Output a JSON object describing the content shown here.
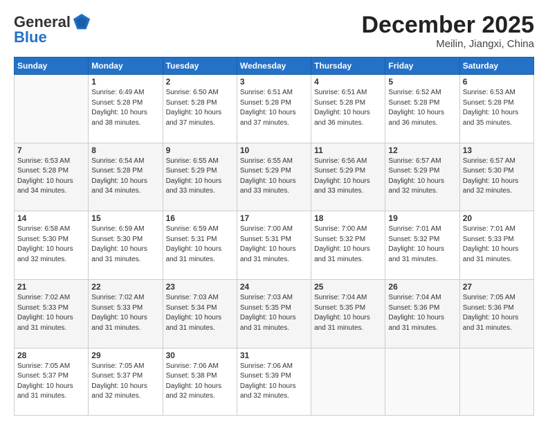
{
  "header": {
    "logo_general": "General",
    "logo_blue": "Blue",
    "month": "December 2025",
    "location": "Meilin, Jiangxi, China"
  },
  "weekdays": [
    "Sunday",
    "Monday",
    "Tuesday",
    "Wednesday",
    "Thursday",
    "Friday",
    "Saturday"
  ],
  "weeks": [
    [
      {
        "day": "",
        "info": ""
      },
      {
        "day": "1",
        "info": "Sunrise: 6:49 AM\nSunset: 5:28 PM\nDaylight: 10 hours\nand 38 minutes."
      },
      {
        "day": "2",
        "info": "Sunrise: 6:50 AM\nSunset: 5:28 PM\nDaylight: 10 hours\nand 37 minutes."
      },
      {
        "day": "3",
        "info": "Sunrise: 6:51 AM\nSunset: 5:28 PM\nDaylight: 10 hours\nand 37 minutes."
      },
      {
        "day": "4",
        "info": "Sunrise: 6:51 AM\nSunset: 5:28 PM\nDaylight: 10 hours\nand 36 minutes."
      },
      {
        "day": "5",
        "info": "Sunrise: 6:52 AM\nSunset: 5:28 PM\nDaylight: 10 hours\nand 36 minutes."
      },
      {
        "day": "6",
        "info": "Sunrise: 6:53 AM\nSunset: 5:28 PM\nDaylight: 10 hours\nand 35 minutes."
      }
    ],
    [
      {
        "day": "7",
        "info": "Sunrise: 6:53 AM\nSunset: 5:28 PM\nDaylight: 10 hours\nand 34 minutes."
      },
      {
        "day": "8",
        "info": "Sunrise: 6:54 AM\nSunset: 5:28 PM\nDaylight: 10 hours\nand 34 minutes."
      },
      {
        "day": "9",
        "info": "Sunrise: 6:55 AM\nSunset: 5:29 PM\nDaylight: 10 hours\nand 33 minutes."
      },
      {
        "day": "10",
        "info": "Sunrise: 6:55 AM\nSunset: 5:29 PM\nDaylight: 10 hours\nand 33 minutes."
      },
      {
        "day": "11",
        "info": "Sunrise: 6:56 AM\nSunset: 5:29 PM\nDaylight: 10 hours\nand 33 minutes."
      },
      {
        "day": "12",
        "info": "Sunrise: 6:57 AM\nSunset: 5:29 PM\nDaylight: 10 hours\nand 32 minutes."
      },
      {
        "day": "13",
        "info": "Sunrise: 6:57 AM\nSunset: 5:30 PM\nDaylight: 10 hours\nand 32 minutes."
      }
    ],
    [
      {
        "day": "14",
        "info": "Sunrise: 6:58 AM\nSunset: 5:30 PM\nDaylight: 10 hours\nand 32 minutes."
      },
      {
        "day": "15",
        "info": "Sunrise: 6:59 AM\nSunset: 5:30 PM\nDaylight: 10 hours\nand 31 minutes."
      },
      {
        "day": "16",
        "info": "Sunrise: 6:59 AM\nSunset: 5:31 PM\nDaylight: 10 hours\nand 31 minutes."
      },
      {
        "day": "17",
        "info": "Sunrise: 7:00 AM\nSunset: 5:31 PM\nDaylight: 10 hours\nand 31 minutes."
      },
      {
        "day": "18",
        "info": "Sunrise: 7:00 AM\nSunset: 5:32 PM\nDaylight: 10 hours\nand 31 minutes."
      },
      {
        "day": "19",
        "info": "Sunrise: 7:01 AM\nSunset: 5:32 PM\nDaylight: 10 hours\nand 31 minutes."
      },
      {
        "day": "20",
        "info": "Sunrise: 7:01 AM\nSunset: 5:33 PM\nDaylight: 10 hours\nand 31 minutes."
      }
    ],
    [
      {
        "day": "21",
        "info": "Sunrise: 7:02 AM\nSunset: 5:33 PM\nDaylight: 10 hours\nand 31 minutes."
      },
      {
        "day": "22",
        "info": "Sunrise: 7:02 AM\nSunset: 5:33 PM\nDaylight: 10 hours\nand 31 minutes."
      },
      {
        "day": "23",
        "info": "Sunrise: 7:03 AM\nSunset: 5:34 PM\nDaylight: 10 hours\nand 31 minutes."
      },
      {
        "day": "24",
        "info": "Sunrise: 7:03 AM\nSunset: 5:35 PM\nDaylight: 10 hours\nand 31 minutes."
      },
      {
        "day": "25",
        "info": "Sunrise: 7:04 AM\nSunset: 5:35 PM\nDaylight: 10 hours\nand 31 minutes."
      },
      {
        "day": "26",
        "info": "Sunrise: 7:04 AM\nSunset: 5:36 PM\nDaylight: 10 hours\nand 31 minutes."
      },
      {
        "day": "27",
        "info": "Sunrise: 7:05 AM\nSunset: 5:36 PM\nDaylight: 10 hours\nand 31 minutes."
      }
    ],
    [
      {
        "day": "28",
        "info": "Sunrise: 7:05 AM\nSunset: 5:37 PM\nDaylight: 10 hours\nand 31 minutes."
      },
      {
        "day": "29",
        "info": "Sunrise: 7:05 AM\nSunset: 5:37 PM\nDaylight: 10 hours\nand 32 minutes."
      },
      {
        "day": "30",
        "info": "Sunrise: 7:06 AM\nSunset: 5:38 PM\nDaylight: 10 hours\nand 32 minutes."
      },
      {
        "day": "31",
        "info": "Sunrise: 7:06 AM\nSunset: 5:39 PM\nDaylight: 10 hours\nand 32 minutes."
      },
      {
        "day": "",
        "info": ""
      },
      {
        "day": "",
        "info": ""
      },
      {
        "day": "",
        "info": ""
      }
    ]
  ]
}
